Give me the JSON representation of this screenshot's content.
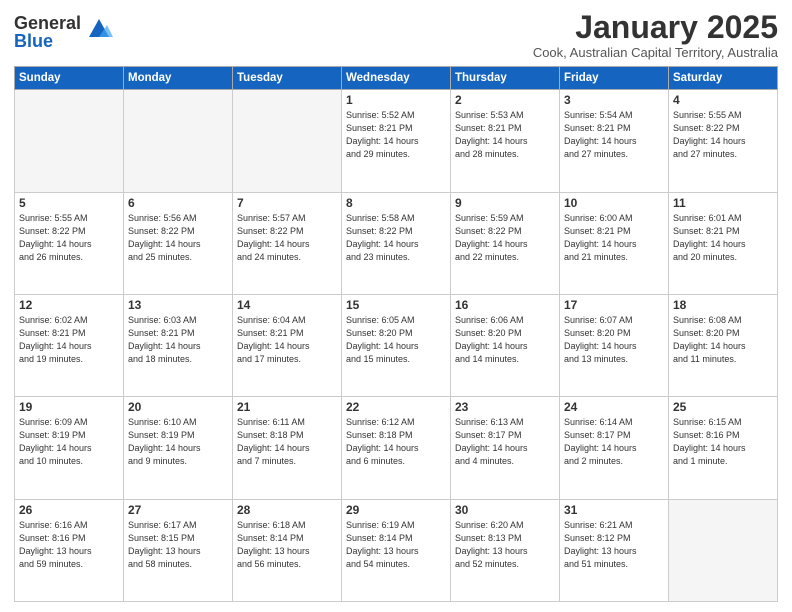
{
  "header": {
    "logo_general": "General",
    "logo_blue": "Blue",
    "month": "January 2025",
    "location": "Cook, Australian Capital Territory, Australia"
  },
  "weekdays": [
    "Sunday",
    "Monday",
    "Tuesday",
    "Wednesday",
    "Thursday",
    "Friday",
    "Saturday"
  ],
  "weeks": [
    [
      {
        "day": "",
        "info": ""
      },
      {
        "day": "",
        "info": ""
      },
      {
        "day": "",
        "info": ""
      },
      {
        "day": "1",
        "info": "Sunrise: 5:52 AM\nSunset: 8:21 PM\nDaylight: 14 hours\nand 29 minutes."
      },
      {
        "day": "2",
        "info": "Sunrise: 5:53 AM\nSunset: 8:21 PM\nDaylight: 14 hours\nand 28 minutes."
      },
      {
        "day": "3",
        "info": "Sunrise: 5:54 AM\nSunset: 8:21 PM\nDaylight: 14 hours\nand 27 minutes."
      },
      {
        "day": "4",
        "info": "Sunrise: 5:55 AM\nSunset: 8:22 PM\nDaylight: 14 hours\nand 27 minutes."
      }
    ],
    [
      {
        "day": "5",
        "info": "Sunrise: 5:55 AM\nSunset: 8:22 PM\nDaylight: 14 hours\nand 26 minutes."
      },
      {
        "day": "6",
        "info": "Sunrise: 5:56 AM\nSunset: 8:22 PM\nDaylight: 14 hours\nand 25 minutes."
      },
      {
        "day": "7",
        "info": "Sunrise: 5:57 AM\nSunset: 8:22 PM\nDaylight: 14 hours\nand 24 minutes."
      },
      {
        "day": "8",
        "info": "Sunrise: 5:58 AM\nSunset: 8:22 PM\nDaylight: 14 hours\nand 23 minutes."
      },
      {
        "day": "9",
        "info": "Sunrise: 5:59 AM\nSunset: 8:22 PM\nDaylight: 14 hours\nand 22 minutes."
      },
      {
        "day": "10",
        "info": "Sunrise: 6:00 AM\nSunset: 8:21 PM\nDaylight: 14 hours\nand 21 minutes."
      },
      {
        "day": "11",
        "info": "Sunrise: 6:01 AM\nSunset: 8:21 PM\nDaylight: 14 hours\nand 20 minutes."
      }
    ],
    [
      {
        "day": "12",
        "info": "Sunrise: 6:02 AM\nSunset: 8:21 PM\nDaylight: 14 hours\nand 19 minutes."
      },
      {
        "day": "13",
        "info": "Sunrise: 6:03 AM\nSunset: 8:21 PM\nDaylight: 14 hours\nand 18 minutes."
      },
      {
        "day": "14",
        "info": "Sunrise: 6:04 AM\nSunset: 8:21 PM\nDaylight: 14 hours\nand 17 minutes."
      },
      {
        "day": "15",
        "info": "Sunrise: 6:05 AM\nSunset: 8:20 PM\nDaylight: 14 hours\nand 15 minutes."
      },
      {
        "day": "16",
        "info": "Sunrise: 6:06 AM\nSunset: 8:20 PM\nDaylight: 14 hours\nand 14 minutes."
      },
      {
        "day": "17",
        "info": "Sunrise: 6:07 AM\nSunset: 8:20 PM\nDaylight: 14 hours\nand 13 minutes."
      },
      {
        "day": "18",
        "info": "Sunrise: 6:08 AM\nSunset: 8:20 PM\nDaylight: 14 hours\nand 11 minutes."
      }
    ],
    [
      {
        "day": "19",
        "info": "Sunrise: 6:09 AM\nSunset: 8:19 PM\nDaylight: 14 hours\nand 10 minutes."
      },
      {
        "day": "20",
        "info": "Sunrise: 6:10 AM\nSunset: 8:19 PM\nDaylight: 14 hours\nand 9 minutes."
      },
      {
        "day": "21",
        "info": "Sunrise: 6:11 AM\nSunset: 8:18 PM\nDaylight: 14 hours\nand 7 minutes."
      },
      {
        "day": "22",
        "info": "Sunrise: 6:12 AM\nSunset: 8:18 PM\nDaylight: 14 hours\nand 6 minutes."
      },
      {
        "day": "23",
        "info": "Sunrise: 6:13 AM\nSunset: 8:17 PM\nDaylight: 14 hours\nand 4 minutes."
      },
      {
        "day": "24",
        "info": "Sunrise: 6:14 AM\nSunset: 8:17 PM\nDaylight: 14 hours\nand 2 minutes."
      },
      {
        "day": "25",
        "info": "Sunrise: 6:15 AM\nSunset: 8:16 PM\nDaylight: 14 hours\nand 1 minute."
      }
    ],
    [
      {
        "day": "26",
        "info": "Sunrise: 6:16 AM\nSunset: 8:16 PM\nDaylight: 13 hours\nand 59 minutes."
      },
      {
        "day": "27",
        "info": "Sunrise: 6:17 AM\nSunset: 8:15 PM\nDaylight: 13 hours\nand 58 minutes."
      },
      {
        "day": "28",
        "info": "Sunrise: 6:18 AM\nSunset: 8:14 PM\nDaylight: 13 hours\nand 56 minutes."
      },
      {
        "day": "29",
        "info": "Sunrise: 6:19 AM\nSunset: 8:14 PM\nDaylight: 13 hours\nand 54 minutes."
      },
      {
        "day": "30",
        "info": "Sunrise: 6:20 AM\nSunset: 8:13 PM\nDaylight: 13 hours\nand 52 minutes."
      },
      {
        "day": "31",
        "info": "Sunrise: 6:21 AM\nSunset: 8:12 PM\nDaylight: 13 hours\nand 51 minutes."
      },
      {
        "day": "",
        "info": ""
      }
    ]
  ]
}
